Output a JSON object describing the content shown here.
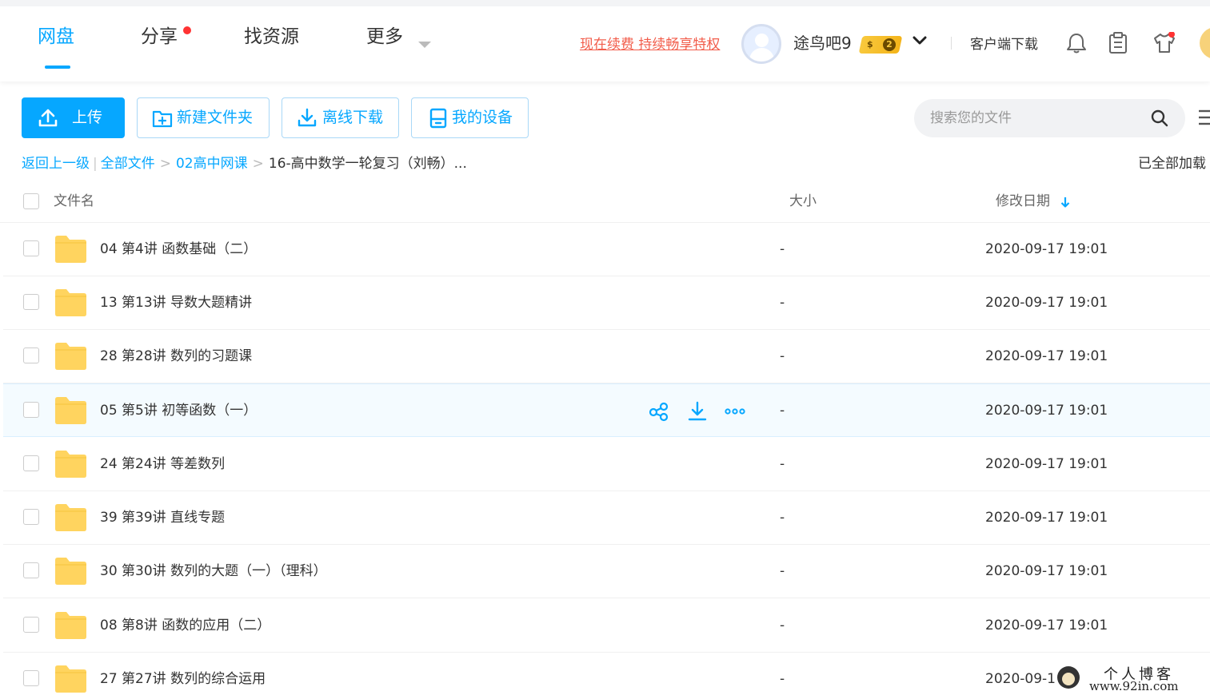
{
  "colors": {
    "accent": "#06a7ff",
    "promo": "#f25d4b",
    "folder": "#ffd45f",
    "badge_gold": "#f8c93d"
  },
  "nav": {
    "tabs": [
      {
        "label": "网盘",
        "active": true
      },
      {
        "label": "分享",
        "has_dot": true
      },
      {
        "label": "找资源"
      },
      {
        "label": "更多",
        "has_caret": true
      }
    ],
    "promo_link": "现在续费 持续畅享特权",
    "username": "途鸟吧9",
    "vip_level": "2",
    "vip_coin": "$",
    "client_download": "客户端下载",
    "icons": [
      "bell-icon",
      "clipboard-icon",
      "shirt-icon"
    ]
  },
  "toolbar": {
    "upload": "上传",
    "new_folder": "新建文件夹",
    "offline_download": "离线下载",
    "my_devices": "我的设备",
    "search_placeholder": "搜索您的文件"
  },
  "breadcrumb": {
    "back": "返回上一级",
    "all_files": "全部文件",
    "level1": "02高中网课",
    "current": "16-高中数学一轮复习（刘畅）...",
    "loaded_status": "已全部加载"
  },
  "table": {
    "headers": {
      "name": "文件名",
      "size": "大小",
      "date": "修改日期"
    },
    "rows": [
      {
        "name": "04 第4讲 函数基础（二）",
        "size": "-",
        "date": "2020-09-17 19:01"
      },
      {
        "name": "13 第13讲 导数大题精讲",
        "size": "-",
        "date": "2020-09-17 19:01"
      },
      {
        "name": "28 第28讲 数列的习题课",
        "size": "-",
        "date": "2020-09-17 19:01"
      },
      {
        "name": "05 第5讲 初等函数（一）",
        "size": "-",
        "date": "2020-09-17 19:01",
        "hover": true
      },
      {
        "name": "24 第24讲 等差数列",
        "size": "-",
        "date": "2020-09-17 19:01"
      },
      {
        "name": "39 第39讲 直线专题",
        "size": "-",
        "date": "2020-09-17 19:01"
      },
      {
        "name": "30 第30讲 数列的大题（一）（理科）",
        "size": "-",
        "date": "2020-09-17 19:01"
      },
      {
        "name": "08 第8讲 函数的应用（二）",
        "size": "-",
        "date": "2020-09-17 19:01"
      },
      {
        "name": "27 第27讲 数列的综合运用",
        "size": "-",
        "date": "2020-09-1"
      }
    ]
  },
  "watermark": {
    "title": "个人博客",
    "url": "www.92in.com"
  }
}
